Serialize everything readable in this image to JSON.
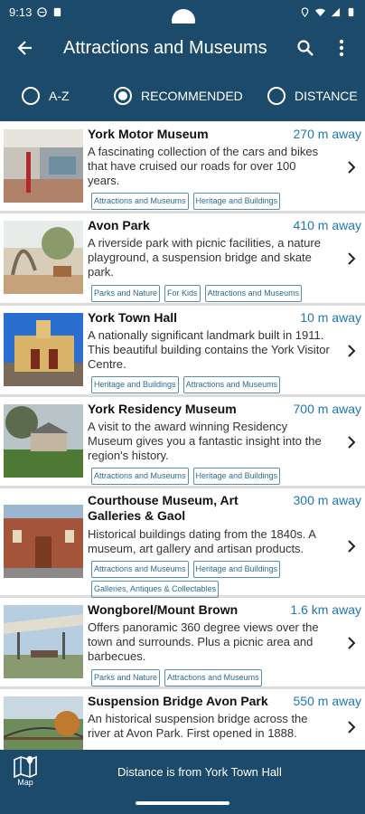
{
  "status_bar": {
    "time": "9:13"
  },
  "app_bar": {
    "title": "Attractions and Museums",
    "back_icon": "arrow-back-icon",
    "search_icon": "search-icon",
    "menu_icon": "more-vert-icon"
  },
  "filters": {
    "options": [
      "A-Z",
      "RECOMMENDED",
      "DISTANCE"
    ],
    "selected": "RECOMMENDED"
  },
  "items": [
    {
      "name": "York Motor Museum",
      "distance": "270 m away",
      "description": "A fascinating collection of the cars and bikes that have cruised our roads for over 100 years.",
      "tags": [
        "Attractions and Museums",
        "Heritage and Buildings"
      ]
    },
    {
      "name": "Avon Park",
      "distance": "410 m away",
      "description": "A riverside park with picnic facilities, a nature playground, a suspension bridge and skate park.",
      "tags": [
        "Parks and Nature",
        "For Kids",
        "Attractions and Museums"
      ]
    },
    {
      "name": "York Town Hall",
      "distance": "10 m away",
      "description": "A nationally significant landmark built in 1911. This beautiful building contains the York Visitor Centre.",
      "tags": [
        "Heritage and Buildings",
        "Attractions and Museums"
      ]
    },
    {
      "name": "York Residency Museum",
      "distance": "700 m away",
      "description": "A visit to the award winning Residency Museum gives you a fantastic insight into the region's history.",
      "tags": [
        "Attractions and Museums",
        "Heritage and Buildings"
      ]
    },
    {
      "name": "Courthouse Museum, Art Galleries & Gaol",
      "distance": "300 m away",
      "description": "Historical buildings dating from the 1840s. A museum, art gallery and artisan products.",
      "tags": [
        "Attractions and Museums",
        "Heritage and Buildings",
        "Galleries, Antiques & Collectables"
      ]
    },
    {
      "name": "Wongborel/Mount Brown",
      "distance": "1.6 km away",
      "description": "Offers panoramic 360 degree views over the town and surrounds. Plus a picnic area and barbecues.",
      "tags": [
        "Parks and Nature",
        "Attractions and Museums"
      ]
    },
    {
      "name": "Suspension Bridge Avon Park",
      "distance": "550 m away",
      "description": "An historical suspension bridge across the river at Avon Park. First opened in 1888.",
      "tags": []
    }
  ],
  "bottom_bar": {
    "map_label": "Map",
    "note": "Distance is from York Town Hall"
  },
  "colors": {
    "primary": "#1b4a6b",
    "distance": "#1f77b4",
    "tag_border": "#5a8bb0"
  }
}
